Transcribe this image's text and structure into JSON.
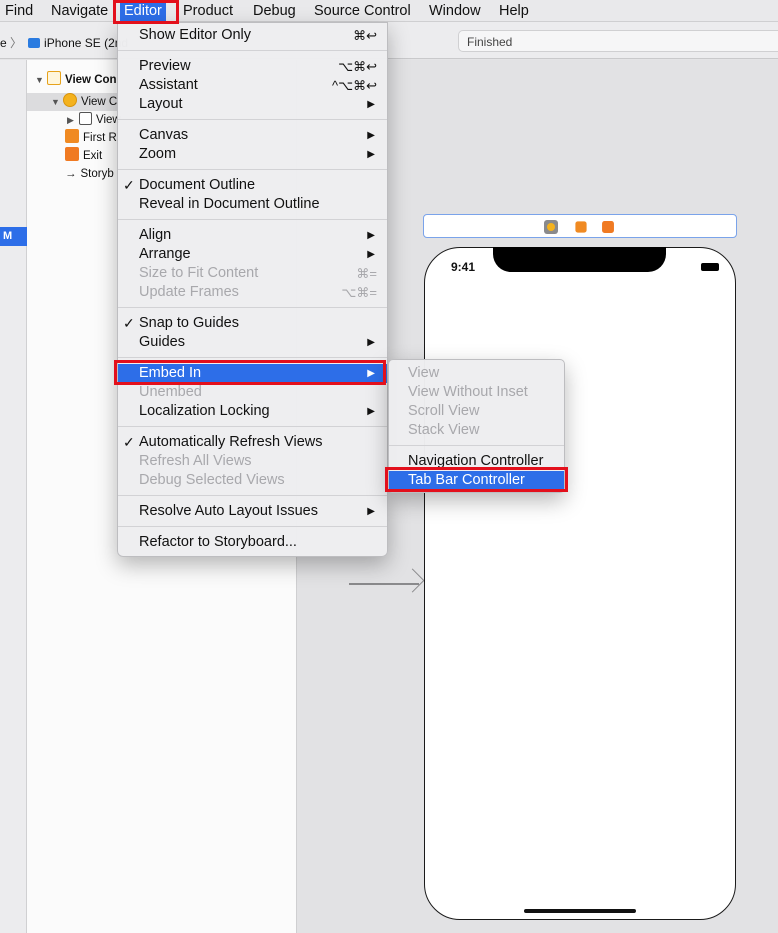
{
  "menubar": {
    "items": [
      "Find",
      "Navigate",
      "Editor",
      "Product",
      "Debug",
      "Source Control",
      "Window",
      "Help"
    ],
    "active": "Editor"
  },
  "toolbar": {
    "scheme_prefix": "e",
    "device": "iPhone SE (2nd",
    "status": "Finished"
  },
  "rail": {
    "badge": "M"
  },
  "outline": {
    "rows": [
      "View Con",
      "View C",
      "View",
      "First R",
      "Exit",
      "Storyb"
    ]
  },
  "phone": {
    "time": "9:41"
  },
  "editor_menu": {
    "show_editor_only": {
      "label": "Show Editor Only",
      "shortcut": "⌘↩"
    },
    "preview": {
      "label": "Preview",
      "shortcut": "⌥⌘↩"
    },
    "assistant": {
      "label": "Assistant",
      "shortcut": "^⌥⌘↩"
    },
    "layout": {
      "label": "Layout"
    },
    "canvas": {
      "label": "Canvas"
    },
    "zoom": {
      "label": "Zoom"
    },
    "document_outline": {
      "label": "Document Outline",
      "checked": true
    },
    "reveal_outline": {
      "label": "Reveal in Document Outline"
    },
    "align": {
      "label": "Align"
    },
    "arrange": {
      "label": "Arrange"
    },
    "size_to_fit": {
      "label": "Size to Fit Content",
      "shortcut": "⌘=",
      "disabled": true
    },
    "update_frames": {
      "label": "Update Frames",
      "shortcut": "⌥⌘=",
      "disabled": true
    },
    "snap_to_guides": {
      "label": "Snap to Guides",
      "checked": true
    },
    "guides": {
      "label": "Guides"
    },
    "embed_in": {
      "label": "Embed In",
      "highlighted": true
    },
    "unembed": {
      "label": "Unembed",
      "disabled": true
    },
    "localization_locking": {
      "label": "Localization Locking"
    },
    "auto_refresh": {
      "label": "Automatically Refresh Views",
      "checked": true
    },
    "refresh_all": {
      "label": "Refresh All Views",
      "disabled": true
    },
    "debug_selected": {
      "label": "Debug Selected Views",
      "disabled": true
    },
    "resolve_auto_layout": {
      "label": "Resolve Auto Layout Issues"
    },
    "refactor_storyboard": {
      "label": "Refactor to Storyboard..."
    }
  },
  "embed_submenu": {
    "view": {
      "label": "View",
      "disabled": true
    },
    "view_without_inset": {
      "label": "View Without Inset",
      "disabled": true
    },
    "scroll_view": {
      "label": "Scroll View",
      "disabled": true
    },
    "stack_view": {
      "label": "Stack View",
      "disabled": true
    },
    "navigation_controller": {
      "label": "Navigation Controller"
    },
    "tab_bar_controller": {
      "label": "Tab Bar Controller",
      "highlighted": true
    }
  },
  "icons": {
    "check": "✓",
    "submenu_arrow": "▶",
    "disclosure_open": "▼",
    "disclosure_closed": "▶",
    "storyboard_arrow": "→"
  },
  "colors": {
    "selection_blue": "#2d6ee8",
    "annotation_red": "#e3101c"
  }
}
